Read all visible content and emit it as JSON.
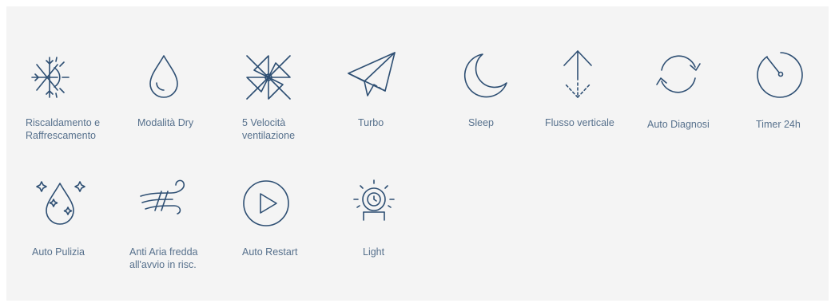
{
  "colors": {
    "panel_bg": "#f4f4f4",
    "icon": "#2e4f73",
    "text": "#56708c"
  },
  "features": [
    {
      "icon": "snowflake-sun-icon",
      "label": "Riscaldamento e\nRaffrescamento"
    },
    {
      "icon": "water-drop-icon",
      "label": "Modalità Dry"
    },
    {
      "icon": "pinwheel-fan-icon",
      "label": "5 Velocità\nventilazione"
    },
    {
      "icon": "paper-plane-icon",
      "label": "Turbo"
    },
    {
      "icon": "moon-icon",
      "label": "Sleep"
    },
    {
      "icon": "vertical-flow-arrow-icon",
      "label": "Flusso verticale"
    },
    {
      "icon": "refresh-arrows-icon",
      "label": "Auto Diagnosi"
    },
    {
      "icon": "timer-icon",
      "label": "Timer 24h"
    },
    {
      "icon": "sparkle-drop-icon",
      "label": "Auto Pulizia"
    },
    {
      "icon": "wind-icon",
      "label": "Anti Aria fredda\nall'avvio in risc."
    },
    {
      "icon": "play-circle-icon",
      "label": "Auto Restart"
    },
    {
      "icon": "light-icon",
      "label": "Light"
    }
  ]
}
